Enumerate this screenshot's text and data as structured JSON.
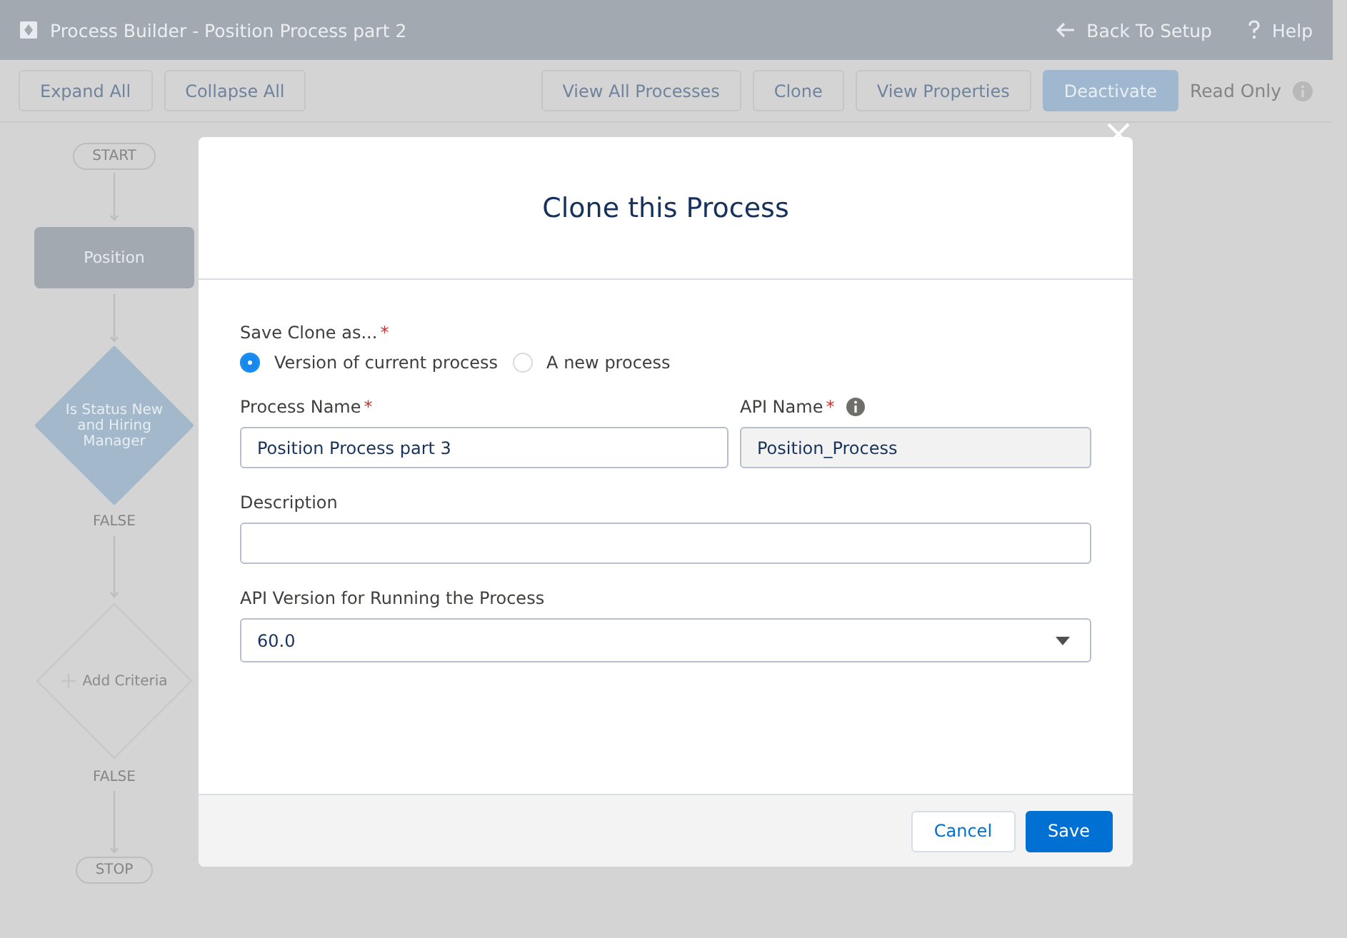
{
  "window": {
    "title": "Process Builder - Position Process part 2",
    "links": [
      {
        "kind": "back",
        "label": "Back To Setup"
      },
      {
        "kind": "help",
        "label": "Help"
      }
    ]
  },
  "toolbar": {
    "left": [
      {
        "label": "Expand All",
        "kind": "neutral"
      },
      {
        "label": "Collapse All",
        "kind": "neutral"
      }
    ],
    "right": [
      {
        "label": "View All Processes",
        "kind": "neutral"
      },
      {
        "label": "Clone",
        "kind": "neutral"
      },
      {
        "label": "View Properties",
        "kind": "neutral"
      },
      {
        "label": "Deactivate",
        "kind": "brand"
      }
    ],
    "status": "Read Only"
  },
  "flow": [
    {
      "kind": "terminal",
      "label": "START"
    },
    {
      "kind": "object",
      "label": "Position"
    },
    {
      "kind": "criteria",
      "label": "Is Status New and Hiring Manager"
    },
    {
      "kind": "outcome",
      "label": "FALSE"
    },
    {
      "kind": "add_criteria",
      "label": "Add Criteria"
    },
    {
      "kind": "outcome",
      "label": "FALSE"
    },
    {
      "kind": "terminal",
      "label": "STOP"
    }
  ],
  "dialog": {
    "title": "Clone this Process",
    "save_as": {
      "label": "Save Clone as...",
      "required_mark": "*",
      "options": [
        {
          "label": "Version of current process",
          "selected": true
        },
        {
          "label": "A new process",
          "selected": false
        }
      ]
    },
    "process_name": {
      "label": "Process Name",
      "required_mark": "*",
      "value": "Position Process part 3",
      "disabled": false
    },
    "api_name": {
      "label": "API Name",
      "required_mark": "*",
      "value": "Position_Process",
      "disabled": true
    },
    "description": {
      "label": "Description"
    },
    "api_version": {
      "label": "API Version for Running the Process",
      "value": "60.0"
    },
    "buttons": [
      {
        "label": "Cancel",
        "kind": "neutral"
      },
      {
        "label": "Save",
        "kind": "brand"
      }
    ]
  }
}
